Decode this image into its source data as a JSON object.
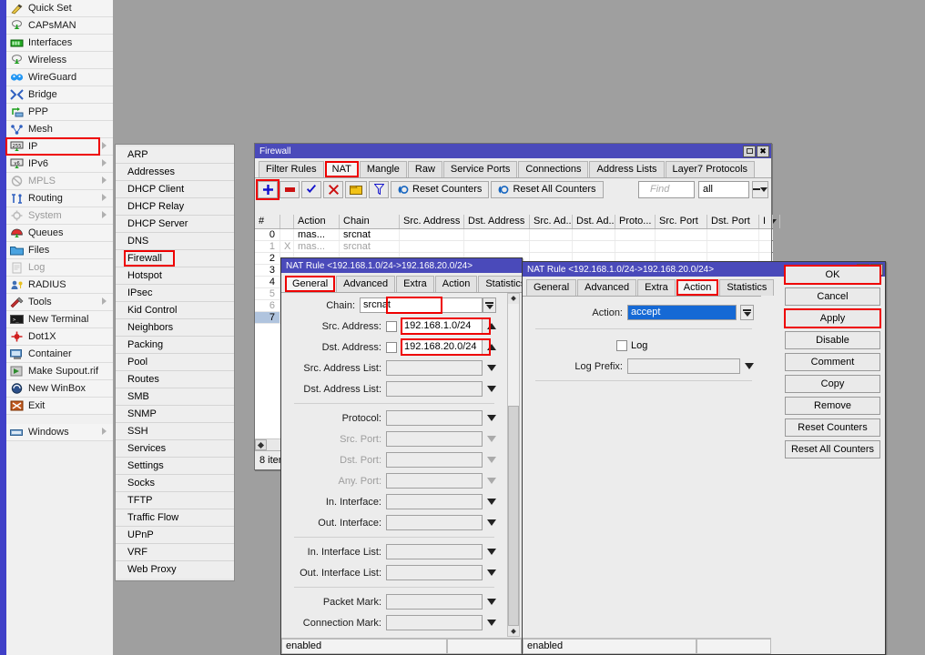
{
  "sidebar": {
    "items": [
      {
        "label": "Quick Set",
        "icon": "wand-icon",
        "arrow": false,
        "dim": false
      },
      {
        "label": "CAPsMAN",
        "icon": "capsman-icon",
        "arrow": false,
        "dim": false
      },
      {
        "label": "Interfaces",
        "icon": "interfaces-icon",
        "arrow": false,
        "dim": false
      },
      {
        "label": "Wireless",
        "icon": "wireless-icon",
        "arrow": false,
        "dim": false
      },
      {
        "label": "WireGuard",
        "icon": "wireguard-icon",
        "arrow": false,
        "dim": false
      },
      {
        "label": "Bridge",
        "icon": "bridge-icon",
        "arrow": false,
        "dim": false
      },
      {
        "label": "PPP",
        "icon": "ppp-icon",
        "arrow": false,
        "dim": false
      },
      {
        "label": "Mesh",
        "icon": "mesh-icon",
        "arrow": false,
        "dim": false
      },
      {
        "label": "IP",
        "icon": "ip-icon",
        "arrow": true,
        "dim": false,
        "highlight": true
      },
      {
        "label": "IPv6",
        "icon": "ipv6-icon",
        "arrow": true,
        "dim": false
      },
      {
        "label": "MPLS",
        "icon": "mpls-icon",
        "arrow": true,
        "dim": true
      },
      {
        "label": "Routing",
        "icon": "routing-icon",
        "arrow": true,
        "dim": false
      },
      {
        "label": "System",
        "icon": "system-icon",
        "arrow": true,
        "dim": true
      },
      {
        "label": "Queues",
        "icon": "queues-icon",
        "arrow": false,
        "dim": false
      },
      {
        "label": "Files",
        "icon": "files-icon",
        "arrow": false,
        "dim": false
      },
      {
        "label": "Log",
        "icon": "log-icon",
        "arrow": false,
        "dim": true
      },
      {
        "label": "RADIUS",
        "icon": "radius-icon",
        "arrow": false,
        "dim": false
      },
      {
        "label": "Tools",
        "icon": "tools-icon",
        "arrow": true,
        "dim": false
      },
      {
        "label": "New Terminal",
        "icon": "terminal-icon",
        "arrow": false,
        "dim": false
      },
      {
        "label": "Dot1X",
        "icon": "dot1x-icon",
        "arrow": false,
        "dim": false
      },
      {
        "label": "Container",
        "icon": "container-icon",
        "arrow": false,
        "dim": false
      },
      {
        "label": "Make Supout.rif",
        "icon": "supout-icon",
        "arrow": false,
        "dim": false
      },
      {
        "label": "New WinBox",
        "icon": "winbox-icon",
        "arrow": false,
        "dim": false
      },
      {
        "label": "Exit",
        "icon": "exit-icon",
        "arrow": false,
        "dim": false
      },
      {
        "label": "",
        "icon": "",
        "arrow": false,
        "gap": true
      },
      {
        "label": "Windows",
        "icon": "windows-icon",
        "arrow": true,
        "dim": false
      }
    ]
  },
  "submenu": {
    "items": [
      {
        "label": "ARP"
      },
      {
        "label": "Addresses"
      },
      {
        "label": "DHCP Client"
      },
      {
        "label": "DHCP Relay"
      },
      {
        "label": "DHCP Server"
      },
      {
        "label": "DNS"
      },
      {
        "label": "Firewall",
        "highlight": true
      },
      {
        "label": "Hotspot"
      },
      {
        "label": "IPsec"
      },
      {
        "label": "Kid Control"
      },
      {
        "label": "Neighbors"
      },
      {
        "label": "Packing"
      },
      {
        "label": "Pool"
      },
      {
        "label": "Routes"
      },
      {
        "label": "SMB"
      },
      {
        "label": "SNMP"
      },
      {
        "label": "SSH"
      },
      {
        "label": "Services"
      },
      {
        "label": "Settings"
      },
      {
        "label": "Socks"
      },
      {
        "label": "TFTP"
      },
      {
        "label": "Traffic Flow"
      },
      {
        "label": "UPnP"
      },
      {
        "label": "VRF"
      },
      {
        "label": "Web Proxy"
      }
    ]
  },
  "firewall": {
    "title": "Firewall",
    "tabs": [
      {
        "label": "Filter Rules",
        "active": false
      },
      {
        "label": "NAT",
        "active": true,
        "highlight": true
      },
      {
        "label": "Mangle",
        "active": false
      },
      {
        "label": "Raw",
        "active": false
      },
      {
        "label": "Service Ports",
        "active": false
      },
      {
        "label": "Connections",
        "active": false
      },
      {
        "label": "Address Lists",
        "active": false
      },
      {
        "label": "Layer7 Protocols",
        "active": false
      }
    ],
    "toolbar": {
      "add_label": "+",
      "remove_label": "–",
      "enable_label": "✔",
      "disable_label": "✖",
      "comment_label": "comment-icon",
      "filter_label": "filter-icon",
      "reset_counters_label": "Reset Counters",
      "reset_all_counters_label": "Reset All Counters",
      "find_placeholder": "Find",
      "filter_value": "all"
    },
    "columns": [
      {
        "label": "#",
        "width": 28
      },
      {
        "label": "",
        "width": 15
      },
      {
        "label": "Action",
        "width": 50
      },
      {
        "label": "Chain",
        "width": 66
      },
      {
        "label": "Src. Address",
        "width": 71
      },
      {
        "label": "Dst. Address",
        "width": 72
      },
      {
        "label": "Src. Ad...",
        "width": 47
      },
      {
        "label": "Dst. Ad...",
        "width": 47
      },
      {
        "label": "Proto...",
        "width": 44
      },
      {
        "label": "Src. Port",
        "width": 57
      },
      {
        "label": "Dst. Port",
        "width": 57
      },
      {
        "label": "I",
        "width": 15
      }
    ],
    "rows": [
      {
        "num": "0",
        "flag": "",
        "action": "mas...",
        "chain": "srcnat",
        "disabled": false,
        "selected": false
      },
      {
        "num": "1",
        "flag": "X",
        "action": "mas...",
        "chain": "srcnat",
        "disabled": true,
        "selected": false
      },
      {
        "num": "2",
        "flag": "",
        "action": "",
        "chain": "",
        "disabled": false,
        "selected": false
      },
      {
        "num": "3",
        "flag": "",
        "action": "",
        "chain": "",
        "disabled": false,
        "selected": false
      },
      {
        "num": "4",
        "flag": "",
        "action": "",
        "chain": "",
        "disabled": false,
        "selected": false
      },
      {
        "num": "5",
        "flag": "X",
        "action": "",
        "chain": "",
        "disabled": true,
        "selected": false
      },
      {
        "num": "6",
        "flag": "X",
        "action": "",
        "chain": "",
        "disabled": true,
        "selected": false
      },
      {
        "num": "7",
        "flag": "",
        "action": "",
        "chain": "",
        "disabled": false,
        "selected": true
      }
    ],
    "status": "8 items"
  },
  "dialog_general": {
    "title": "NAT Rule <192.168.1.0/24->192.168.20.0/24>",
    "tabs": [
      {
        "label": "General",
        "active": true,
        "highlight": true
      },
      {
        "label": "Advanced",
        "active": false
      },
      {
        "label": "Extra",
        "active": false
      },
      {
        "label": "Action",
        "active": false
      },
      {
        "label": "Statistics",
        "active": false
      }
    ],
    "fields": [
      {
        "label": "Chain:",
        "value": "srcnat",
        "type": "combo-text",
        "highlight": true,
        "dim": false
      },
      {
        "label": "Src. Address:",
        "value": "192.168.1.0/24",
        "type": "checkbox-text-up",
        "highlight": true,
        "dim": false
      },
      {
        "label": "Dst. Address:",
        "value": "192.168.20.0/24",
        "type": "checkbox-text-up",
        "highlight": true,
        "dim": false
      },
      {
        "label": "Src. Address List:",
        "value": "",
        "type": "combo",
        "dim": false
      },
      {
        "label": "Dst. Address List:",
        "value": "",
        "type": "combo",
        "dim": false
      },
      {
        "label": "__hr__"
      },
      {
        "label": "Protocol:",
        "value": "",
        "type": "combo",
        "dim": false
      },
      {
        "label": "Src. Port:",
        "value": "",
        "type": "combo",
        "dim": true
      },
      {
        "label": "Dst. Port:",
        "value": "",
        "type": "combo",
        "dim": true
      },
      {
        "label": "Any. Port:",
        "value": "",
        "type": "combo",
        "dim": true
      },
      {
        "label": "In. Interface:",
        "value": "",
        "type": "combo",
        "dim": false
      },
      {
        "label": "Out. Interface:",
        "value": "",
        "type": "combo",
        "dim": false
      },
      {
        "label": "__hr__"
      },
      {
        "label": "In. Interface List:",
        "value": "",
        "type": "combo",
        "dim": false
      },
      {
        "label": "Out. Interface List:",
        "value": "",
        "type": "combo",
        "dim": false
      },
      {
        "label": "__hr__"
      },
      {
        "label": "Packet Mark:",
        "value": "",
        "type": "combo",
        "dim": false
      },
      {
        "label": "Connection Mark:",
        "value": "",
        "type": "combo",
        "dim": false
      }
    ],
    "status": "enabled"
  },
  "dialog_action": {
    "title": "NAT Rule <192.168.1.0/24->192.168.20.0/24>",
    "tabs": [
      {
        "label": "General",
        "active": false
      },
      {
        "label": "Advanced",
        "active": false
      },
      {
        "label": "Extra",
        "active": false
      },
      {
        "label": "Action",
        "active": true,
        "highlight": true
      },
      {
        "label": "Statistics",
        "active": false
      }
    ],
    "action_label": "Action:",
    "action_value": "accept",
    "log_label": "Log",
    "log_prefix_label": "Log Prefix:",
    "log_prefix_value": "",
    "buttons": [
      {
        "label": "OK",
        "highlight": true
      },
      {
        "label": "Cancel",
        "highlight": false
      },
      {
        "label": "Apply",
        "highlight": true
      },
      {
        "label": "Disable",
        "highlight": false
      },
      {
        "label": "Comment",
        "highlight": false
      },
      {
        "label": "Copy",
        "highlight": false
      },
      {
        "label": "Remove",
        "highlight": false
      },
      {
        "label": "Reset Counters",
        "highlight": false
      },
      {
        "label": "Reset All Counters",
        "highlight": false
      }
    ],
    "status": "enabled"
  },
  "colors": {
    "titlebar": "#4a4aba",
    "rail": "#4040c8",
    "highlight_red": "#ee0000",
    "selection_blue": "#1569d5",
    "row_select": "#b0c4de",
    "desktop": "#9f9f9f"
  }
}
